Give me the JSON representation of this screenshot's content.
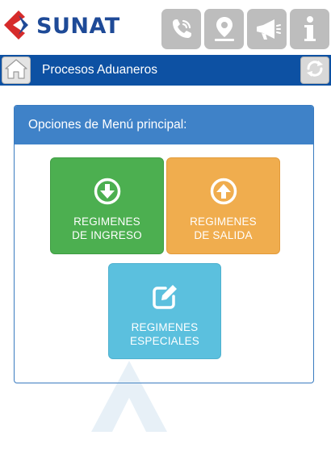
{
  "brand": {
    "name": "SUNAT",
    "logo_icon": "sunat-logo-icon",
    "colors": {
      "red": "#d62b2b",
      "blue": "#1e4a97"
    }
  },
  "top_icons": [
    {
      "name": "phone-icon"
    },
    {
      "name": "location-pin-icon"
    },
    {
      "name": "megaphone-icon"
    },
    {
      "name": "info-icon"
    }
  ],
  "titlebar": {
    "title": "Procesos Aduaneros",
    "home_icon": "home-icon",
    "refresh_icon": "refresh-icon",
    "color": "#0d51a3"
  },
  "panel": {
    "header": "Opciones de Menú principal:",
    "header_color": "#3f82c8"
  },
  "tiles": [
    {
      "line1": "REGIMENES",
      "line2": "DE INGRESO",
      "icon": "arrow-down-circle-icon",
      "color": "#4caf50"
    },
    {
      "line1": "REGIMENES",
      "line2": "DE SALIDA",
      "icon": "arrow-up-circle-icon",
      "color": "#f0ad4e"
    },
    {
      "line1": "REGIMENES",
      "line2": "ESPECIALES",
      "icon": "edit-square-icon",
      "color": "#5bc0de"
    }
  ]
}
